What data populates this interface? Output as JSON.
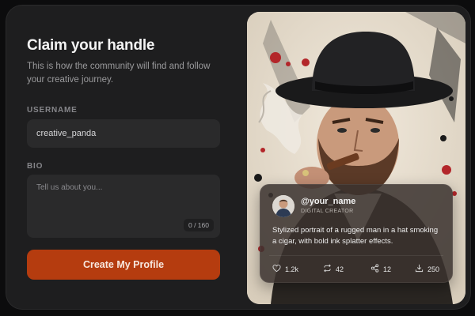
{
  "form": {
    "title": "Claim your handle",
    "subtitle": "This is how the community will find and follow your creative journey.",
    "username": {
      "label": "USERNAME",
      "value": "creative_panda"
    },
    "bio": {
      "label": "BIO",
      "placeholder": "Tell us about you...",
      "counter": "0 / 160"
    },
    "submit_label": "Create My Profile"
  },
  "preview": {
    "handle": "@your_name",
    "role": "DIGITAL CREATOR",
    "description": "Stylized portrait of a rugged man in a hat smoking a cigar, with bold ink splatter effects.",
    "stats": {
      "likes": "1.2k",
      "reposts": "42",
      "shares": "12",
      "downloads": "250"
    },
    "icons": [
      "heart-icon",
      "repost-icon",
      "share-icon",
      "download-icon"
    ]
  },
  "colors": {
    "accent": "#b53c0f",
    "panel": "#1e1e1f",
    "field": "#2a2a2b"
  }
}
